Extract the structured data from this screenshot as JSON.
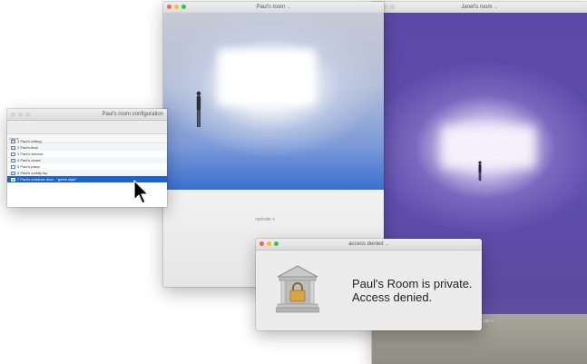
{
  "janet_window": {
    "title": "Janet's room",
    "title_chevron": "⌄",
    "sign": "…ate <"
  },
  "paul_window": {
    "title": "Paul's room",
    "title_chevron": "⌄",
    "sign": ">private <"
  },
  "config_window": {
    "title": "Paul's room configuration",
    "column_header": "Name",
    "items": [
      {
        "label": "1 Paul's ceiling",
        "icon": "grid-icon"
      },
      {
        "label": "2 Paul's floor",
        "icon": "grid-icon"
      },
      {
        "label": "3 Paul's window",
        "icon": "frame-icon"
      },
      {
        "label": "4 Paul's closet",
        "icon": "grid-icon"
      },
      {
        "label": "5 Paul's piano",
        "icon": "frame-icon"
      },
      {
        "label": "6 Paul's cuddly toy",
        "icon": "grid-icon"
      },
      {
        "label": "7 Paul's entrance door - \"greek style\"",
        "icon": "grid-icon",
        "selected": true
      }
    ]
  },
  "dialog": {
    "title": "access denied",
    "title_chevron": "⌄",
    "message_line1": "Paul's Room is private.",
    "message_line2": "Access denied.",
    "icon": "padlock-temple-icon"
  },
  "colors": {
    "selection": "#1d63c8",
    "close": "#fc5f57",
    "minimize": "#fdbc2e",
    "maximize": "#28c840"
  }
}
